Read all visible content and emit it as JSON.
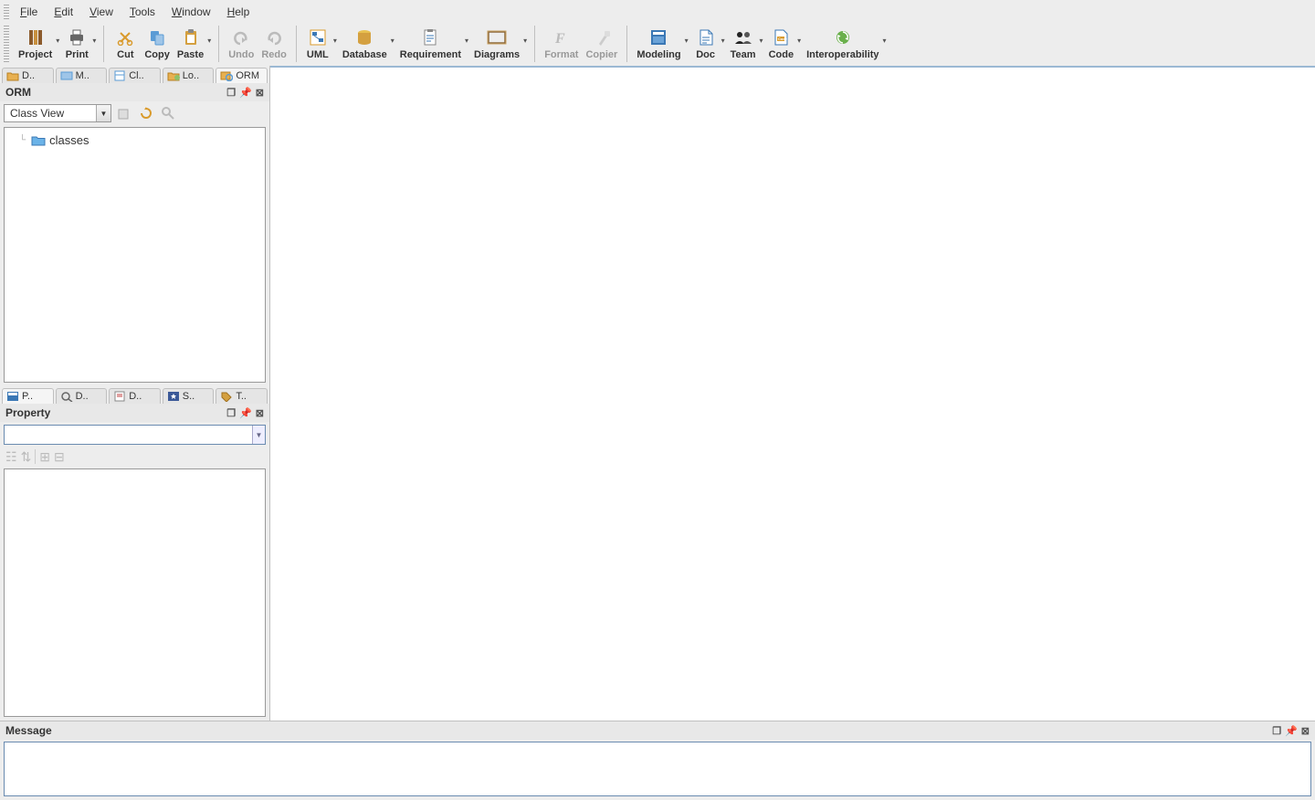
{
  "menubar": {
    "items": [
      {
        "label": "File",
        "underline": 0
      },
      {
        "label": "Edit",
        "underline": 0
      },
      {
        "label": "View",
        "underline": 0
      },
      {
        "label": "Tools",
        "underline": 0
      },
      {
        "label": "Window",
        "underline": 0
      },
      {
        "label": "Help",
        "underline": 0
      }
    ]
  },
  "toolbar": {
    "project": "Project",
    "print": "Print",
    "cut": "Cut",
    "copy": "Copy",
    "paste": "Paste",
    "undo": "Undo",
    "redo": "Redo",
    "uml": "UML",
    "database": "Database",
    "requirement": "Requirement",
    "diagrams": "Diagrams",
    "format": "Format",
    "copier": "Copier",
    "modeling": "Modeling",
    "doc": "Doc",
    "team": "Team",
    "code": "Code",
    "interoperability": "Interoperability"
  },
  "leftTopTabs": {
    "items": [
      "D..",
      "M..",
      "Cl..",
      "Lo..",
      "ORM"
    ],
    "activeIndex": 4
  },
  "ormPanel": {
    "title": "ORM",
    "comboSelected": "Class View",
    "tree": {
      "nodes": [
        {
          "label": "classes"
        }
      ]
    }
  },
  "leftBottomTabs": {
    "items": [
      "P..",
      "D..",
      "D..",
      "S..",
      "T.."
    ],
    "activeIndex": 0
  },
  "propertyPanel": {
    "title": "Property",
    "currentValue": ""
  },
  "messagePanel": {
    "title": "Message"
  }
}
